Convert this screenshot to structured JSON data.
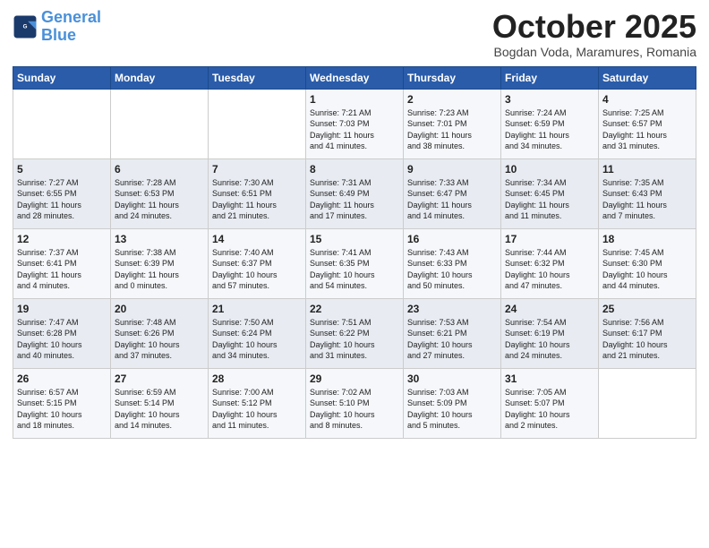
{
  "header": {
    "logo_line1": "General",
    "logo_line2": "Blue",
    "month": "October 2025",
    "location": "Bogdan Voda, Maramures, Romania"
  },
  "days_of_week": [
    "Sunday",
    "Monday",
    "Tuesday",
    "Wednesday",
    "Thursday",
    "Friday",
    "Saturday"
  ],
  "weeks": [
    [
      {
        "day": "",
        "info": ""
      },
      {
        "day": "",
        "info": ""
      },
      {
        "day": "",
        "info": ""
      },
      {
        "day": "1",
        "info": "Sunrise: 7:21 AM\nSunset: 7:03 PM\nDaylight: 11 hours\nand 41 minutes."
      },
      {
        "day": "2",
        "info": "Sunrise: 7:23 AM\nSunset: 7:01 PM\nDaylight: 11 hours\nand 38 minutes."
      },
      {
        "day": "3",
        "info": "Sunrise: 7:24 AM\nSunset: 6:59 PM\nDaylight: 11 hours\nand 34 minutes."
      },
      {
        "day": "4",
        "info": "Sunrise: 7:25 AM\nSunset: 6:57 PM\nDaylight: 11 hours\nand 31 minutes."
      }
    ],
    [
      {
        "day": "5",
        "info": "Sunrise: 7:27 AM\nSunset: 6:55 PM\nDaylight: 11 hours\nand 28 minutes."
      },
      {
        "day": "6",
        "info": "Sunrise: 7:28 AM\nSunset: 6:53 PM\nDaylight: 11 hours\nand 24 minutes."
      },
      {
        "day": "7",
        "info": "Sunrise: 7:30 AM\nSunset: 6:51 PM\nDaylight: 11 hours\nand 21 minutes."
      },
      {
        "day": "8",
        "info": "Sunrise: 7:31 AM\nSunset: 6:49 PM\nDaylight: 11 hours\nand 17 minutes."
      },
      {
        "day": "9",
        "info": "Sunrise: 7:33 AM\nSunset: 6:47 PM\nDaylight: 11 hours\nand 14 minutes."
      },
      {
        "day": "10",
        "info": "Sunrise: 7:34 AM\nSunset: 6:45 PM\nDaylight: 11 hours\nand 11 minutes."
      },
      {
        "day": "11",
        "info": "Sunrise: 7:35 AM\nSunset: 6:43 PM\nDaylight: 11 hours\nand 7 minutes."
      }
    ],
    [
      {
        "day": "12",
        "info": "Sunrise: 7:37 AM\nSunset: 6:41 PM\nDaylight: 11 hours\nand 4 minutes."
      },
      {
        "day": "13",
        "info": "Sunrise: 7:38 AM\nSunset: 6:39 PM\nDaylight: 11 hours\nand 0 minutes."
      },
      {
        "day": "14",
        "info": "Sunrise: 7:40 AM\nSunset: 6:37 PM\nDaylight: 10 hours\nand 57 minutes."
      },
      {
        "day": "15",
        "info": "Sunrise: 7:41 AM\nSunset: 6:35 PM\nDaylight: 10 hours\nand 54 minutes."
      },
      {
        "day": "16",
        "info": "Sunrise: 7:43 AM\nSunset: 6:33 PM\nDaylight: 10 hours\nand 50 minutes."
      },
      {
        "day": "17",
        "info": "Sunrise: 7:44 AM\nSunset: 6:32 PM\nDaylight: 10 hours\nand 47 minutes."
      },
      {
        "day": "18",
        "info": "Sunrise: 7:45 AM\nSunset: 6:30 PM\nDaylight: 10 hours\nand 44 minutes."
      }
    ],
    [
      {
        "day": "19",
        "info": "Sunrise: 7:47 AM\nSunset: 6:28 PM\nDaylight: 10 hours\nand 40 minutes."
      },
      {
        "day": "20",
        "info": "Sunrise: 7:48 AM\nSunset: 6:26 PM\nDaylight: 10 hours\nand 37 minutes."
      },
      {
        "day": "21",
        "info": "Sunrise: 7:50 AM\nSunset: 6:24 PM\nDaylight: 10 hours\nand 34 minutes."
      },
      {
        "day": "22",
        "info": "Sunrise: 7:51 AM\nSunset: 6:22 PM\nDaylight: 10 hours\nand 31 minutes."
      },
      {
        "day": "23",
        "info": "Sunrise: 7:53 AM\nSunset: 6:21 PM\nDaylight: 10 hours\nand 27 minutes."
      },
      {
        "day": "24",
        "info": "Sunrise: 7:54 AM\nSunset: 6:19 PM\nDaylight: 10 hours\nand 24 minutes."
      },
      {
        "day": "25",
        "info": "Sunrise: 7:56 AM\nSunset: 6:17 PM\nDaylight: 10 hours\nand 21 minutes."
      }
    ],
    [
      {
        "day": "26",
        "info": "Sunrise: 6:57 AM\nSunset: 5:15 PM\nDaylight: 10 hours\nand 18 minutes."
      },
      {
        "day": "27",
        "info": "Sunrise: 6:59 AM\nSunset: 5:14 PM\nDaylight: 10 hours\nand 14 minutes."
      },
      {
        "day": "28",
        "info": "Sunrise: 7:00 AM\nSunset: 5:12 PM\nDaylight: 10 hours\nand 11 minutes."
      },
      {
        "day": "29",
        "info": "Sunrise: 7:02 AM\nSunset: 5:10 PM\nDaylight: 10 hours\nand 8 minutes."
      },
      {
        "day": "30",
        "info": "Sunrise: 7:03 AM\nSunset: 5:09 PM\nDaylight: 10 hours\nand 5 minutes."
      },
      {
        "day": "31",
        "info": "Sunrise: 7:05 AM\nSunset: 5:07 PM\nDaylight: 10 hours\nand 2 minutes."
      },
      {
        "day": "",
        "info": ""
      }
    ]
  ]
}
